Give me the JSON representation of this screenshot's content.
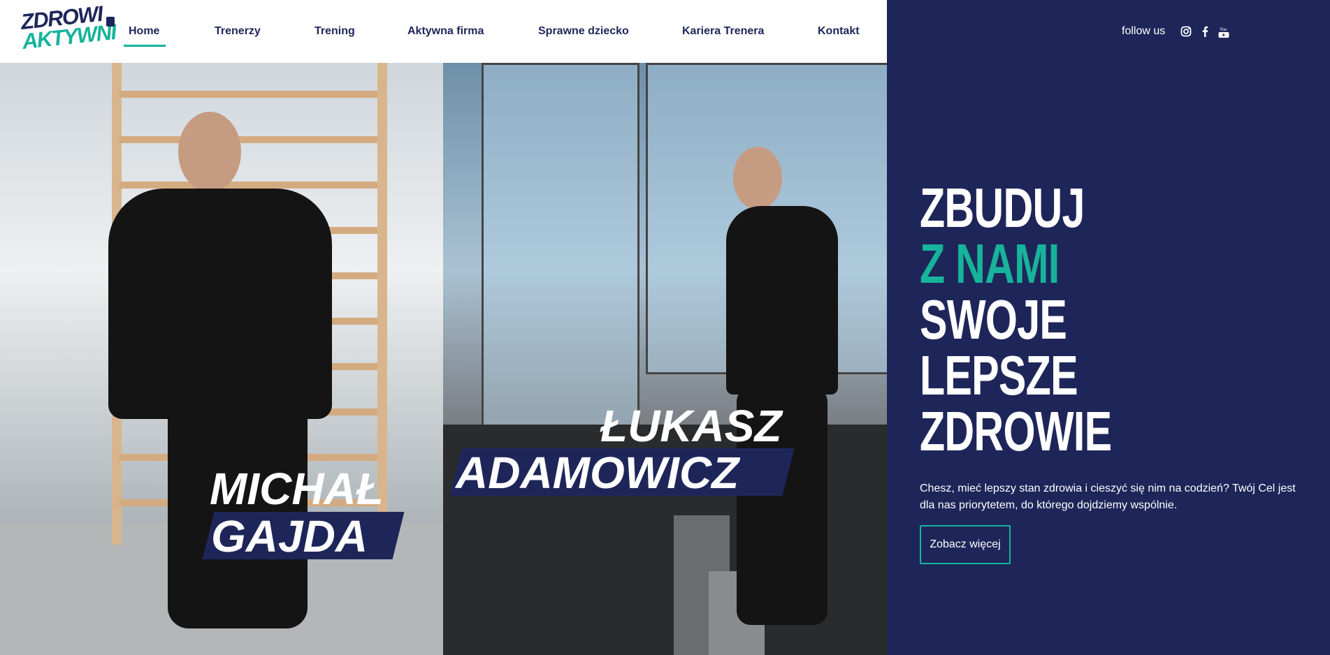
{
  "brand": {
    "logo_line1": "ZDROWI",
    "logo_line2": "AKTYWNI"
  },
  "nav": {
    "items": [
      "Home",
      "Trenerzy",
      "Trening",
      "Aktywna firma",
      "Sprawne dziecko",
      "Kariera Trenera",
      "Kontakt"
    ],
    "active": "Home"
  },
  "social": {
    "label": "follow us",
    "icons": [
      "instagram-icon",
      "facebook-icon",
      "youtube-icon"
    ],
    "icon_glyphs": {
      "instagram": "◎",
      "facebook": "f",
      "youtube": "▶"
    }
  },
  "hero": {
    "headline": [
      "ZBUDUJ",
      "Z NAMI",
      "SWOJE",
      "LEPSZE",
      "ZDROWIE"
    ],
    "description": "Chesz, mieć lepszy stan zdrowia i cieszyć się nim na codzień? Twój Cel jest dla nas priorytetem, do którego dojdziemy wspólnie.",
    "cta_label": "Zobacz więcej"
  },
  "trainers": [
    {
      "first": "MICHAŁ",
      "last": "GAJDA"
    },
    {
      "first": "ŁUKASZ",
      "last": "ADAMOWICZ"
    }
  ],
  "colors": {
    "navy": "#1e2659",
    "teal": "#17b39b",
    "white": "#ffffff"
  }
}
